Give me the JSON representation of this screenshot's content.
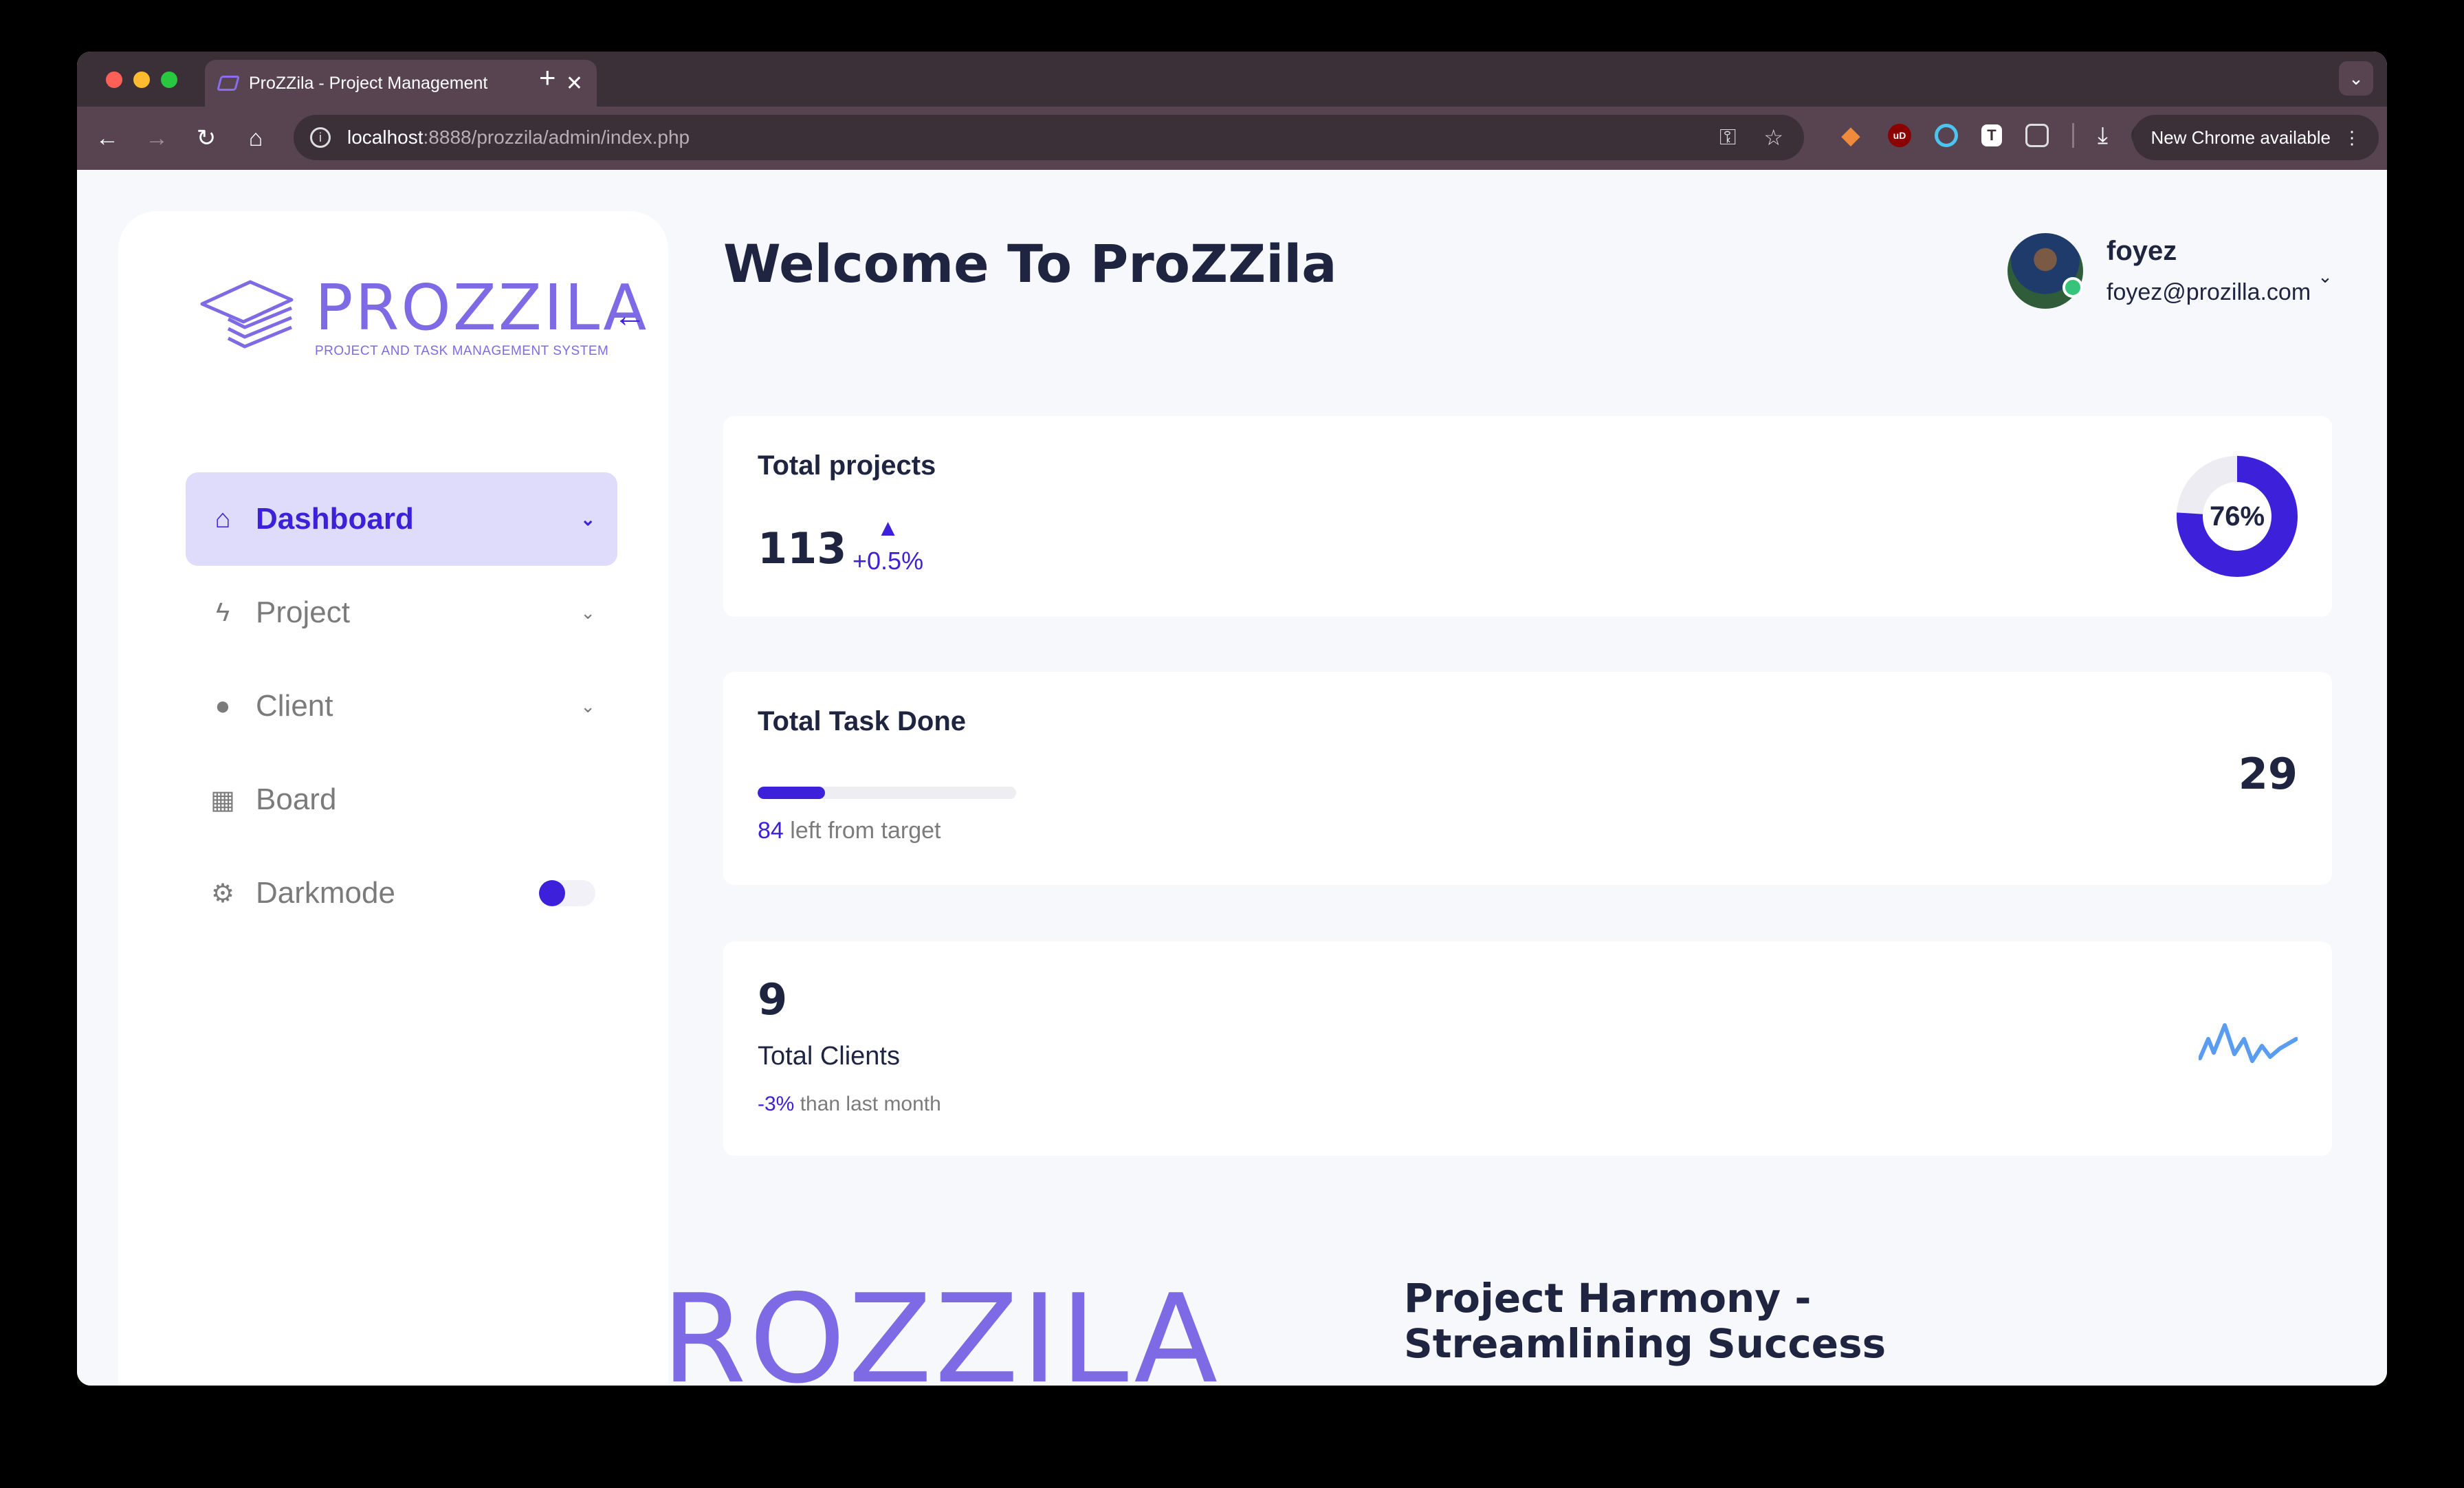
{
  "browser": {
    "tab_title": "ProZZila - Project Management",
    "url_host": "localhost",
    "url_path": ":8888/prozzila/admin/index.php",
    "update_label": "New Chrome available"
  },
  "sidebar": {
    "logo_title": "PROZZILA",
    "logo_subtitle": "PROJECT AND TASK MANAGEMENT SYSTEM",
    "items": [
      {
        "label": "Dashboard",
        "icon": "home-icon",
        "active": true,
        "has_chevron": true
      },
      {
        "label": "Project",
        "icon": "bolt-icon",
        "active": false,
        "has_chevron": true
      },
      {
        "label": "Client",
        "icon": "user-icon",
        "active": false,
        "has_chevron": true
      },
      {
        "label": "Board",
        "icon": "grid-icon",
        "active": false,
        "has_chevron": false
      },
      {
        "label": "Darkmode",
        "icon": "gear-icon",
        "active": false,
        "has_chevron": false
      }
    ],
    "darkmode_on": false
  },
  "main": {
    "title": "Welcome To ProZZila"
  },
  "profile": {
    "name": "foyez",
    "email": "foyez@prozilla.com",
    "status": "online"
  },
  "cards": {
    "projects": {
      "title": "Total projects",
      "value": "113",
      "trend": "+0.5%",
      "donut_percent": 76,
      "donut_label": "76%"
    },
    "tasks": {
      "title": "Total Task Done",
      "value": "29",
      "progress_fraction": 0.26,
      "left_count": "84",
      "left_text": " left from target"
    },
    "clients": {
      "value": "9",
      "label": "Total Clients",
      "change": "-3%",
      "change_text": " than last month"
    }
  },
  "footer": {
    "logo_text": "ROZZILA",
    "heading": "Project Harmony - Streamlining Success"
  },
  "colors": {
    "accent": "#3d20d9",
    "brand": "#7f6ae6",
    "active_bg": "#dedcfa",
    "sparkline": "#5a9cf0",
    "online": "#36c47a"
  }
}
